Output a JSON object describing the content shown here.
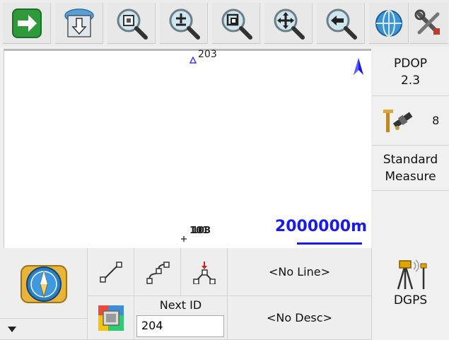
{
  "toolbar": {
    "buttons": [
      {
        "name": "next-arrow-icon"
      },
      {
        "name": "import-down-icon"
      },
      {
        "name": "zoom-extents-icon"
      },
      {
        "name": "zoom-in-out-icon"
      },
      {
        "name": "zoom-window-icon"
      },
      {
        "name": "pan-icon"
      },
      {
        "name": "zoom-previous-icon"
      },
      {
        "name": "globe-icon"
      },
      {
        "name": "settings-tools-icon"
      }
    ]
  },
  "map": {
    "points": [
      {
        "label": "203"
      },
      {
        "label": "101"
      },
      {
        "label": "103"
      }
    ],
    "scale_label": "2000000m"
  },
  "side_panel": {
    "pdop_title": "PDOP",
    "pdop_value": "2.3",
    "satellite_count": "8",
    "measure_mode_line1": "Standard",
    "measure_mode_line2": "Measure",
    "gps_mode": "DGPS"
  },
  "bottom_panel": {
    "line_label": "<No Line>",
    "next_id_label": "Next ID",
    "next_id_value": "204",
    "desc_label": "<No Desc>"
  },
  "colors": {
    "accent_blue": "#1a1aee",
    "arrow_green": "#2e9a3a"
  }
}
